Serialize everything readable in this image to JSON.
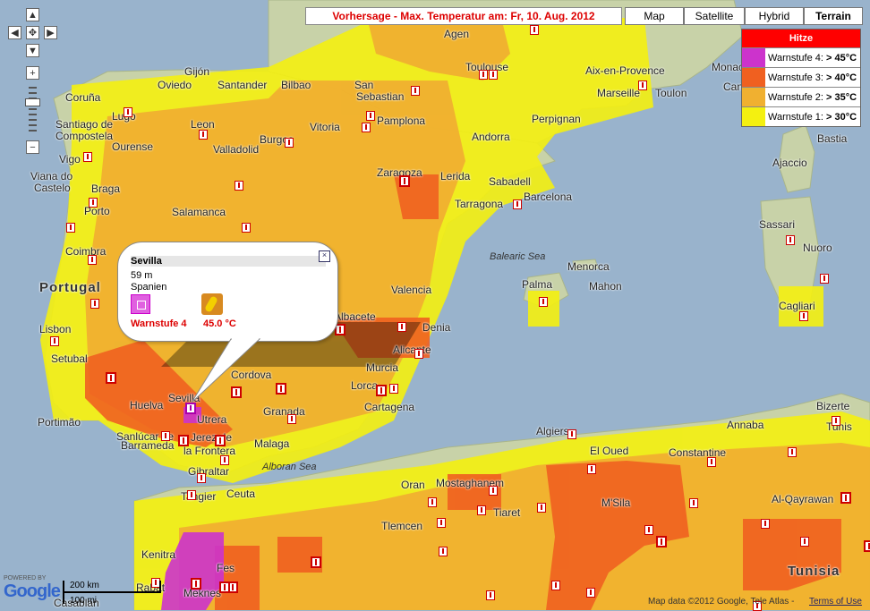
{
  "title": "Vorhersage - Max. Temperatur am: Fr, 10. Aug. 2012",
  "map_types": [
    {
      "label": "Map",
      "selected": false
    },
    {
      "label": "Satellite",
      "selected": false
    },
    {
      "label": "Hybrid",
      "selected": false
    },
    {
      "label": "Terrain",
      "selected": true
    }
  ],
  "legend": {
    "header": "Hitze",
    "rows": [
      {
        "label": "Warnstufe 4:",
        "value": "> 45°C",
        "color": "#cc33cc"
      },
      {
        "label": "Warnstufe 3:",
        "value": "> 40°C",
        "color": "#f06020"
      },
      {
        "label": "Warnstufe 2:",
        "value": "> 35°C",
        "color": "#f0b030"
      },
      {
        "label": "Warnstufe 1:",
        "value": "> 30°C",
        "color": "#f4f010"
      }
    ]
  },
  "nav": {
    "up_icon": "▲",
    "down_icon": "▼",
    "left_icon": "◀",
    "right_icon": "▶",
    "center_icon": "✥",
    "zoom_in": "+",
    "zoom_out": "−"
  },
  "info": {
    "title": "Sevilla",
    "elevation": "59 m",
    "country": "Spanien",
    "warn_text": "Warnstufe 4",
    "temp_text": "45.0  °C",
    "close_icon": "×"
  },
  "place_labels": [
    {
      "t": "Agen"
    },
    {
      "t": "Toulouse"
    },
    {
      "t": "Aix-en-Provence"
    },
    {
      "t": "Monac"
    },
    {
      "t": "Cannes"
    },
    {
      "t": "Marseille"
    },
    {
      "t": "Toulon"
    },
    {
      "t": "Perpignan"
    },
    {
      "t": "Andorra"
    },
    {
      "t": "Gijón"
    },
    {
      "t": "Oviedo"
    },
    {
      "t": "Santander"
    },
    {
      "t": "Bilbao"
    },
    {
      "t": "San"
    },
    {
      "t": "Sebastian"
    },
    {
      "t": "Vitoria"
    },
    {
      "t": "Pamplona"
    },
    {
      "t": "Coruña"
    },
    {
      "t": "Lugo"
    },
    {
      "t": "Leon"
    },
    {
      "t": "Santiago de"
    },
    {
      "t": "Compostela"
    },
    {
      "t": "Ourense"
    },
    {
      "t": "Burgos"
    },
    {
      "t": "Vigo"
    },
    {
      "t": "Viana do"
    },
    {
      "t": "Castelo"
    },
    {
      "t": "Braga"
    },
    {
      "t": "Valladolid"
    },
    {
      "t": "Zaragoza"
    },
    {
      "t": "Lerida"
    },
    {
      "t": "Sabadell"
    },
    {
      "t": "Barcelona"
    },
    {
      "t": "Tarragona"
    },
    {
      "t": "Porto"
    },
    {
      "t": "Salamanca"
    },
    {
      "t": "Coimbra"
    },
    {
      "t": "Portugal"
    },
    {
      "t": "Valencia"
    },
    {
      "t": "Albacete"
    },
    {
      "t": "Lisbon"
    },
    {
      "t": "Setubal"
    },
    {
      "t": "Portimão"
    },
    {
      "t": "Sevilla"
    },
    {
      "t": "Huelva"
    },
    {
      "t": "Cordova"
    },
    {
      "t": "Murcia"
    },
    {
      "t": "Lorca"
    },
    {
      "t": "Denia"
    },
    {
      "t": "Alicante"
    },
    {
      "t": "Cartagena"
    },
    {
      "t": "Granada"
    },
    {
      "t": "Utrera"
    },
    {
      "t": "Sanlúcar de"
    },
    {
      "t": "Barrameda"
    },
    {
      "t": "Jerez de"
    },
    {
      "t": "la Frontera"
    },
    {
      "t": "Malaga"
    },
    {
      "t": "Gibraltar"
    },
    {
      "t": "Tangier"
    },
    {
      "t": "Ceuta"
    },
    {
      "t": "Oran"
    },
    {
      "t": "Mostaghanem"
    },
    {
      "t": "Tlemcen"
    },
    {
      "t": "Tiaret"
    },
    {
      "t": "Algiers"
    },
    {
      "t": "El Oued"
    },
    {
      "t": "M'Sila"
    },
    {
      "t": "Constantine"
    },
    {
      "t": "Annaba"
    },
    {
      "t": "Bizerte"
    },
    {
      "t": "Tunis"
    },
    {
      "t": "Al-Qayrawan"
    },
    {
      "t": "Tunisia"
    },
    {
      "t": "Kenitra"
    },
    {
      "t": "Rabat"
    },
    {
      "t": "Fes"
    },
    {
      "t": "Meknes"
    },
    {
      "t": "Casablan"
    },
    {
      "t": "Palma"
    },
    {
      "t": "Menorca"
    },
    {
      "t": "Mahon"
    },
    {
      "t": "Sassari"
    },
    {
      "t": "Nuoro"
    },
    {
      "t": "Cagliari"
    },
    {
      "t": "Ajaccio"
    },
    {
      "t": "Bastia"
    }
  ],
  "sea_labels": [
    {
      "t": "Balearic Sea"
    },
    {
      "t": "Alboran Sea"
    }
  ],
  "scale": {
    "km": "200 km",
    "mi": "100 mi"
  },
  "powered_by": "POWERED BY",
  "logo": "Google",
  "copyright": "Map data ©2012 Google, Tele Atlas -",
  "terms": "Terms of Use"
}
